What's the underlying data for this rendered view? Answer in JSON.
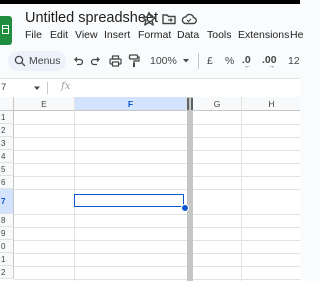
{
  "app": {
    "title": "Untitled spreadsheet"
  },
  "menu": [
    "File",
    "Edit",
    "View",
    "Insert",
    "Format",
    "Data",
    "Tools",
    "Extensions",
    "He"
  ],
  "toolbar": {
    "menus_label": "Menus",
    "zoom": "100%",
    "currency_symbol": "£",
    "percent_symbol": "%",
    "decrease_decimal": ".0",
    "increase_decimal": ".00",
    "more_formats": "12"
  },
  "formula_bar": {
    "name_box": "7",
    "fx": "fx",
    "value": ""
  },
  "grid": {
    "columns": [
      "E",
      "F",
      "G",
      "H"
    ],
    "rows": [
      "1",
      "2",
      "3",
      "4",
      "5",
      "6",
      "7",
      "8",
      "9",
      "0",
      "1",
      "2"
    ],
    "selected_column": "F",
    "selected_row": "7"
  },
  "colors": {
    "accent": "#0b57d0",
    "selection_fill": "#d3e3fd",
    "logo_green": "#1e8e3e"
  },
  "icons": [
    "star-icon",
    "move-to-folder-icon",
    "cloud-status-icon",
    "search-icon",
    "undo-icon",
    "redo-icon",
    "print-icon",
    "paint-format-icon",
    "dropdown-arrow-icon"
  ]
}
